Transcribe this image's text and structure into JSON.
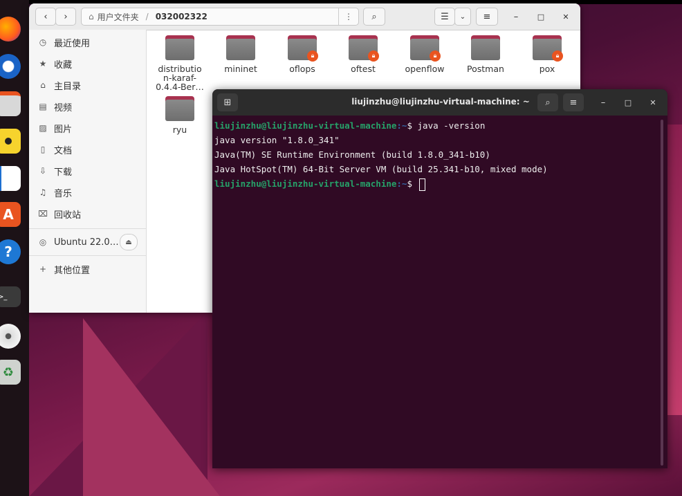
{
  "file_manager": {
    "nav": {
      "back": "‹",
      "forward": "›"
    },
    "path": {
      "home_label": "用户文件夹",
      "separator": "/",
      "current": "032002322"
    },
    "sidebar": {
      "items": [
        {
          "icon": "clock-icon",
          "glyph": "◷",
          "label": "最近使用"
        },
        {
          "icon": "star-icon",
          "glyph": "★",
          "label": "收藏"
        },
        {
          "icon": "home-icon",
          "glyph": "⌂",
          "label": "主目录"
        },
        {
          "icon": "video-icon",
          "glyph": "▤",
          "label": "视频"
        },
        {
          "icon": "picture-icon",
          "glyph": "▨",
          "label": "图片"
        },
        {
          "icon": "document-icon",
          "glyph": "▯",
          "label": "文档"
        },
        {
          "icon": "download-icon",
          "glyph": "⇩",
          "label": "下载"
        },
        {
          "icon": "music-icon",
          "glyph": "♫",
          "label": "音乐"
        },
        {
          "icon": "trash-icon",
          "glyph": "⌧",
          "label": "回收站"
        }
      ],
      "drive": {
        "label": "Ubuntu 22.0…",
        "eject": "⏏"
      },
      "other": {
        "glyph": "+",
        "label": "其他位置"
      }
    },
    "folders": [
      {
        "name": "distributio\nn-karaf-\n0.4.4-Ber…",
        "locked": false
      },
      {
        "name": "mininet",
        "locked": false
      },
      {
        "name": "oflops",
        "locked": true
      },
      {
        "name": "oftest",
        "locked": true
      },
      {
        "name": "openflow",
        "locked": true
      },
      {
        "name": "Postman",
        "locked": false
      },
      {
        "name": "pox",
        "locked": true
      },
      {
        "name": "ryu",
        "locked": false
      }
    ],
    "window_controls": {
      "minimize": "–",
      "maximize": "□",
      "close": "✕"
    }
  },
  "terminal": {
    "title": "liujinzhu@liujinzhu-virtual-machine: ~",
    "window_controls": {
      "minimize": "–",
      "maximize": "□",
      "close": "✕"
    },
    "lines": [
      {
        "user": "liujinzhu@liujinzhu-virtual-machine",
        "path": ":~",
        "cmd": "$ java -version"
      },
      {
        "text": "java version \"1.8.0_341\""
      },
      {
        "text": "Java(TM) SE Runtime Environment (build 1.8.0_341-b10)"
      },
      {
        "text": "Java HotSpot(TM) 64-Bit Server VM (build 25.341-b10, mixed mode)"
      },
      {
        "user": "liujinzhu@liujinzhu-virtual-machine",
        "path": ":~",
        "cmd": "$ "
      }
    ]
  },
  "colors": {
    "accent": "#e95420",
    "terminal_bg": "#300a24",
    "prompt_green": "#26a269"
  }
}
